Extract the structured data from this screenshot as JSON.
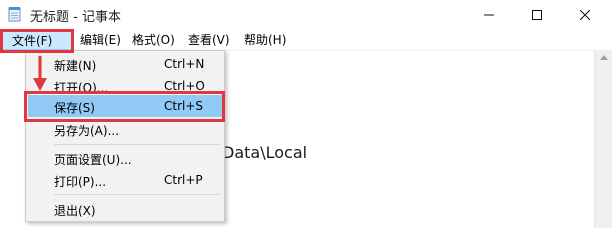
{
  "window": {
    "title": "无标题 - 记事本"
  },
  "menubar": {
    "items": [
      "文件(F)",
      "编辑(E)",
      "格式(O)",
      "查看(V)",
      "帮助(H)"
    ]
  },
  "editor": {
    "visible_text": "Data\\Local"
  },
  "file_menu": {
    "items": [
      {
        "label": "新建(N)",
        "shortcut": "Ctrl+N"
      },
      {
        "label": "打开(O)...",
        "shortcut": "Ctrl+O"
      },
      {
        "label": "保存(S)",
        "shortcut": "Ctrl+S",
        "highlighted": true
      },
      {
        "label": "另存为(A)...",
        "shortcut": ""
      },
      {
        "label": "页面设置(U)...",
        "shortcut": ""
      },
      {
        "label": "打印(P)...",
        "shortcut": "Ctrl+P"
      },
      {
        "label": "退出(X)",
        "shortcut": ""
      }
    ]
  },
  "colors": {
    "annotation_red": "#e0383e",
    "selection_blue": "#91c9f7",
    "menu_bg": "#f2f2f2"
  },
  "icons": [
    "notepad-icon",
    "minimize-icon",
    "maximize-icon",
    "close-icon",
    "arrow-down-icon"
  ]
}
